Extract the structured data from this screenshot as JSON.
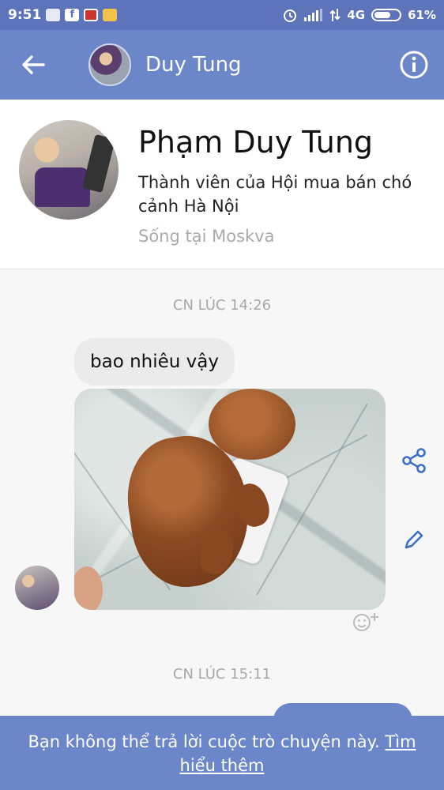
{
  "status_bar": {
    "time": "9:51",
    "network": "4G",
    "battery": "61%",
    "notification_icons": [
      "messenger-icon",
      "facebook-icon",
      "calendar-icon",
      "app-icon"
    ]
  },
  "header": {
    "title": "Duy Tung",
    "back_icon": "arrow-left-icon",
    "info_icon": "info-icon"
  },
  "profile": {
    "name": "Phạm Duy Tung",
    "description": "Thành viên của Hội mua bán chó cảnh Hà Nội",
    "location": "Sống tại Moskva"
  },
  "conversation": {
    "timestamp_1": "CN LÚC 14:26",
    "message_text": "bao nhiêu vậy",
    "timestamp_2": "CN LÚC 15:11"
  },
  "footer": {
    "notice": "Bạn không thể trả lời cuộc trò chuyện này.",
    "link": "Tìm hiểu thêm"
  },
  "colors": {
    "status_bar": "#5d73ba",
    "header": "#6b86c9",
    "accent_icon": "#3d6fc4",
    "bubble": "#ebebeb"
  }
}
